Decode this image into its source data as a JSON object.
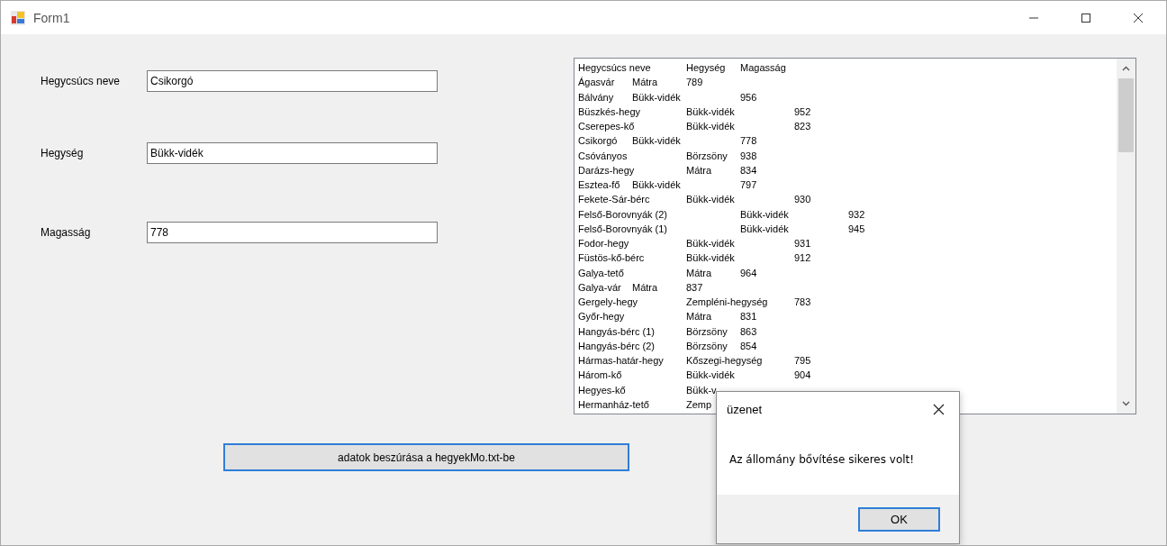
{
  "window": {
    "title": "Form1"
  },
  "fields": [
    {
      "label": "Hegycsúcs neve",
      "value": "Csikorgó"
    },
    {
      "label": "Hegység",
      "value": "Bükk-vidék"
    },
    {
      "label": "Magasság",
      "value": "778"
    }
  ],
  "list": {
    "items": [
      "Hegycsúcs neve\tHegység\tMagasság",
      "Ágasvár\tMátra\t789",
      "Bálvány\tBükk-vidék\t\t956",
      "Büszkés-hegy\tBükk-vidék\t\t952",
      "Cserepes-kő\tBükk-vidék\t\t823",
      "Csikorgó\tBükk-vidék\t\t778",
      "Csóványos\t\tBörzsöny\t938",
      "Darázs-hegy\tMátra\t834",
      "Esztea-fő\tBükk-vidék\t\t797",
      "Fekete-Sár-bérc\tBükk-vidék\t\t930",
      "Felső-Borovnyák (2)\t\tBükk-vidék\t\t932",
      "Felső-Borovnyák (1)\t\tBükk-vidék\t\t945",
      "Fodor-hegy\t\tBükk-vidék\t\t931",
      "Füstös-kő-bérc\tBükk-vidék\t\t912",
      "Galya-tető\t\tMátra\t964",
      "Galya-vár\tMátra\t837",
      "Gergely-hegy\tZempléni-hegység\t783",
      "Győr-hegy\t\tMátra\t831",
      "Hangyás-bérc (1)\tBörzsöny\t863",
      "Hangyás-bérc (2)\tBörzsöny\t854",
      "Hármas-határ-hegy\tKőszegi-hegység\t795",
      "Három-kő\t\tBükk-vidék\t\t904",
      "Hegyes-kő\t\tBükk-v",
      "Hermanház-tető\tZemp"
    ]
  },
  "button": "adatok beszúrása a hegyekMo.txt-be",
  "dialog": {
    "title": "üzenet",
    "message": "Az állomány bővítése sikeres volt!",
    "button": "OK"
  }
}
